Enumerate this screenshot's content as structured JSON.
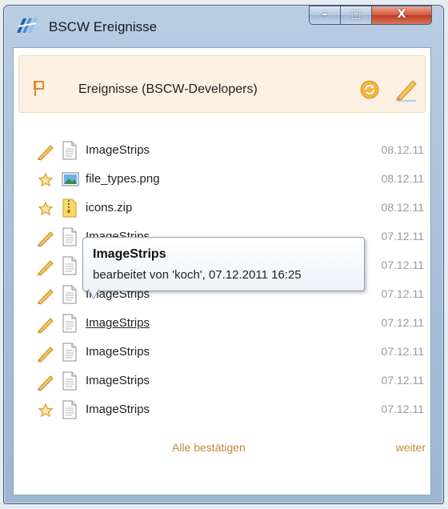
{
  "window": {
    "title": "BSCW Ereignisse",
    "icons": {
      "app": "bscw-app-icon",
      "minimize": "minimize-icon",
      "maximize": "maximize-icon",
      "close": "close-icon"
    },
    "controls": {
      "minimize": "–",
      "maximize": "□",
      "close": "X"
    }
  },
  "header": {
    "title": "Ereignisse (BSCW-Developers)",
    "icons": {
      "flag": "flag-icon",
      "refresh": "refresh-icon",
      "edit": "pencil-icon"
    }
  },
  "events": [
    {
      "type": "edit",
      "event_icon": "pencil-icon",
      "file_icon": "document-icon",
      "name": "ImageStrips",
      "date": "08.12.11"
    },
    {
      "type": "new",
      "event_icon": "star-icon",
      "file_icon": "image-file-icon",
      "name": "file_types.png",
      "date": "08.12.11"
    },
    {
      "type": "new",
      "event_icon": "star-icon",
      "file_icon": "zip-file-icon",
      "name": "icons.zip",
      "date": "08.12.11"
    },
    {
      "type": "edit",
      "event_icon": "pencil-icon",
      "file_icon": "document-icon",
      "name": "ImageStrips",
      "date": "07.12.11"
    },
    {
      "type": "edit",
      "event_icon": "pencil-icon",
      "file_icon": "document-icon",
      "name": "ImageStrips",
      "date": "07.12.11"
    },
    {
      "type": "edit",
      "event_icon": "pencil-icon",
      "file_icon": "document-icon",
      "name": "ImageStrips",
      "date": "07.12.11"
    },
    {
      "type": "edit",
      "event_icon": "pencil-icon",
      "file_icon": "document-icon",
      "name": "ImageStrips",
      "date": "07.12.11",
      "hovered": true
    },
    {
      "type": "edit",
      "event_icon": "pencil-icon",
      "file_icon": "document-icon",
      "name": "ImageStrips",
      "date": "07.12.11"
    },
    {
      "type": "edit",
      "event_icon": "pencil-icon",
      "file_icon": "document-icon",
      "name": "ImageStrips",
      "date": "07.12.11"
    },
    {
      "type": "new",
      "event_icon": "star-icon",
      "file_icon": "document-icon",
      "name": "ImageStrips",
      "date": "07.12.11"
    }
  ],
  "tooltip": {
    "title": "ImageStrips",
    "detail": "bearbeitet von 'koch', 07.12.2011 16:25"
  },
  "footer": {
    "confirm_all": "Alle bestätigen",
    "next": "weiter"
  },
  "colors": {
    "accent": "#c8873a",
    "date": "#9a9a9a",
    "header_bg": "#fbf0e1"
  }
}
